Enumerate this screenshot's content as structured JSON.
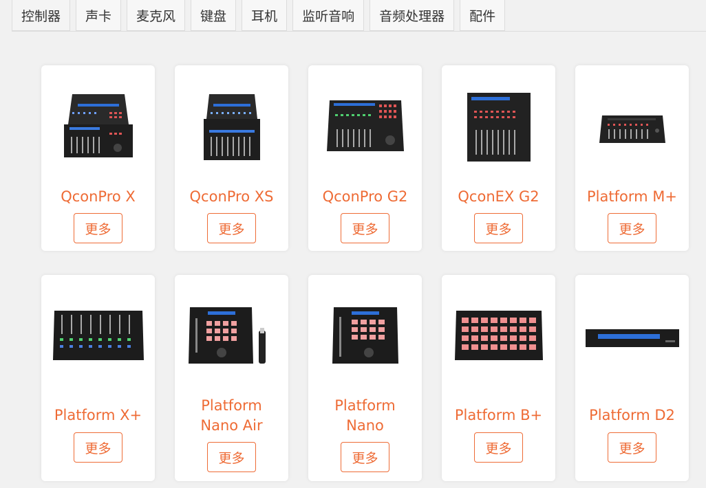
{
  "tabs": [
    "控制器",
    "声卡",
    "麦克风",
    "键盘",
    "耳机",
    "监听音响",
    "音频处理器",
    "配件"
  ],
  "more_label": "更多",
  "products_row1": [
    {
      "name_lines": [
        "QconPro X"
      ]
    },
    {
      "name_lines": [
        "QconPro XS"
      ]
    },
    {
      "name_lines": [
        "QconPro G2"
      ]
    },
    {
      "name_lines": [
        "QconEX G2"
      ]
    },
    {
      "name_lines": [
        "Platform M+"
      ]
    }
  ],
  "products_row2": [
    {
      "name_lines": [
        "Platform X+"
      ]
    },
    {
      "name_lines": [
        "Platform",
        "Nano Air"
      ]
    },
    {
      "name_lines": [
        "Platform",
        "Nano"
      ]
    },
    {
      "name_lines": [
        "Platform B+"
      ]
    },
    {
      "name_lines": [
        "Platform D2"
      ]
    }
  ],
  "colors": {
    "accent": "#ee6b35",
    "page_bg": "#f1f1f1",
    "card_bg": "#ffffff"
  }
}
